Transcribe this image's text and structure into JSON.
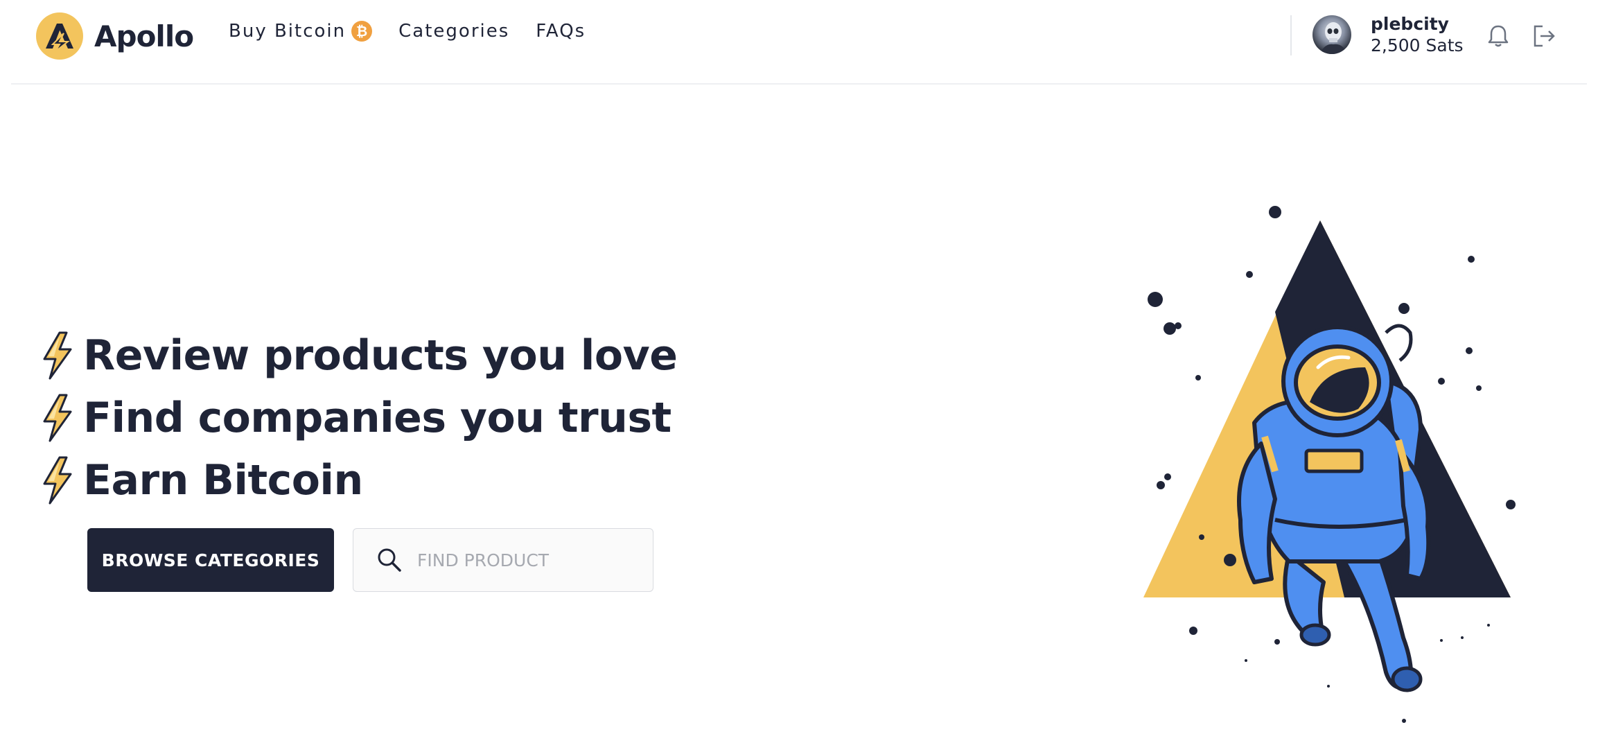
{
  "header": {
    "brand": "Apollo",
    "nav": {
      "buy_bitcoin": "Buy Bitcoin",
      "bitcoin_badge": "₿",
      "categories": "Categories",
      "faqs": "FAQs"
    },
    "user": {
      "name": "plebcity",
      "balance": "2,500 Sats"
    },
    "icons": [
      "logo-icon",
      "bitcoin-icon",
      "avatar",
      "bell-icon",
      "logout-icon"
    ]
  },
  "hero": {
    "lines": [
      "Review products you love",
      "Find companies you trust",
      "Earn Bitcoin"
    ],
    "browse_label": "BROWSE CATEGORIES",
    "search_placeholder": "FIND PRODUCT"
  },
  "colors": {
    "navy": "#1f2437",
    "gold": "#f3c45d",
    "bitcoin_orange": "#f0a040",
    "astronaut_blue": "#4f8ff0"
  }
}
